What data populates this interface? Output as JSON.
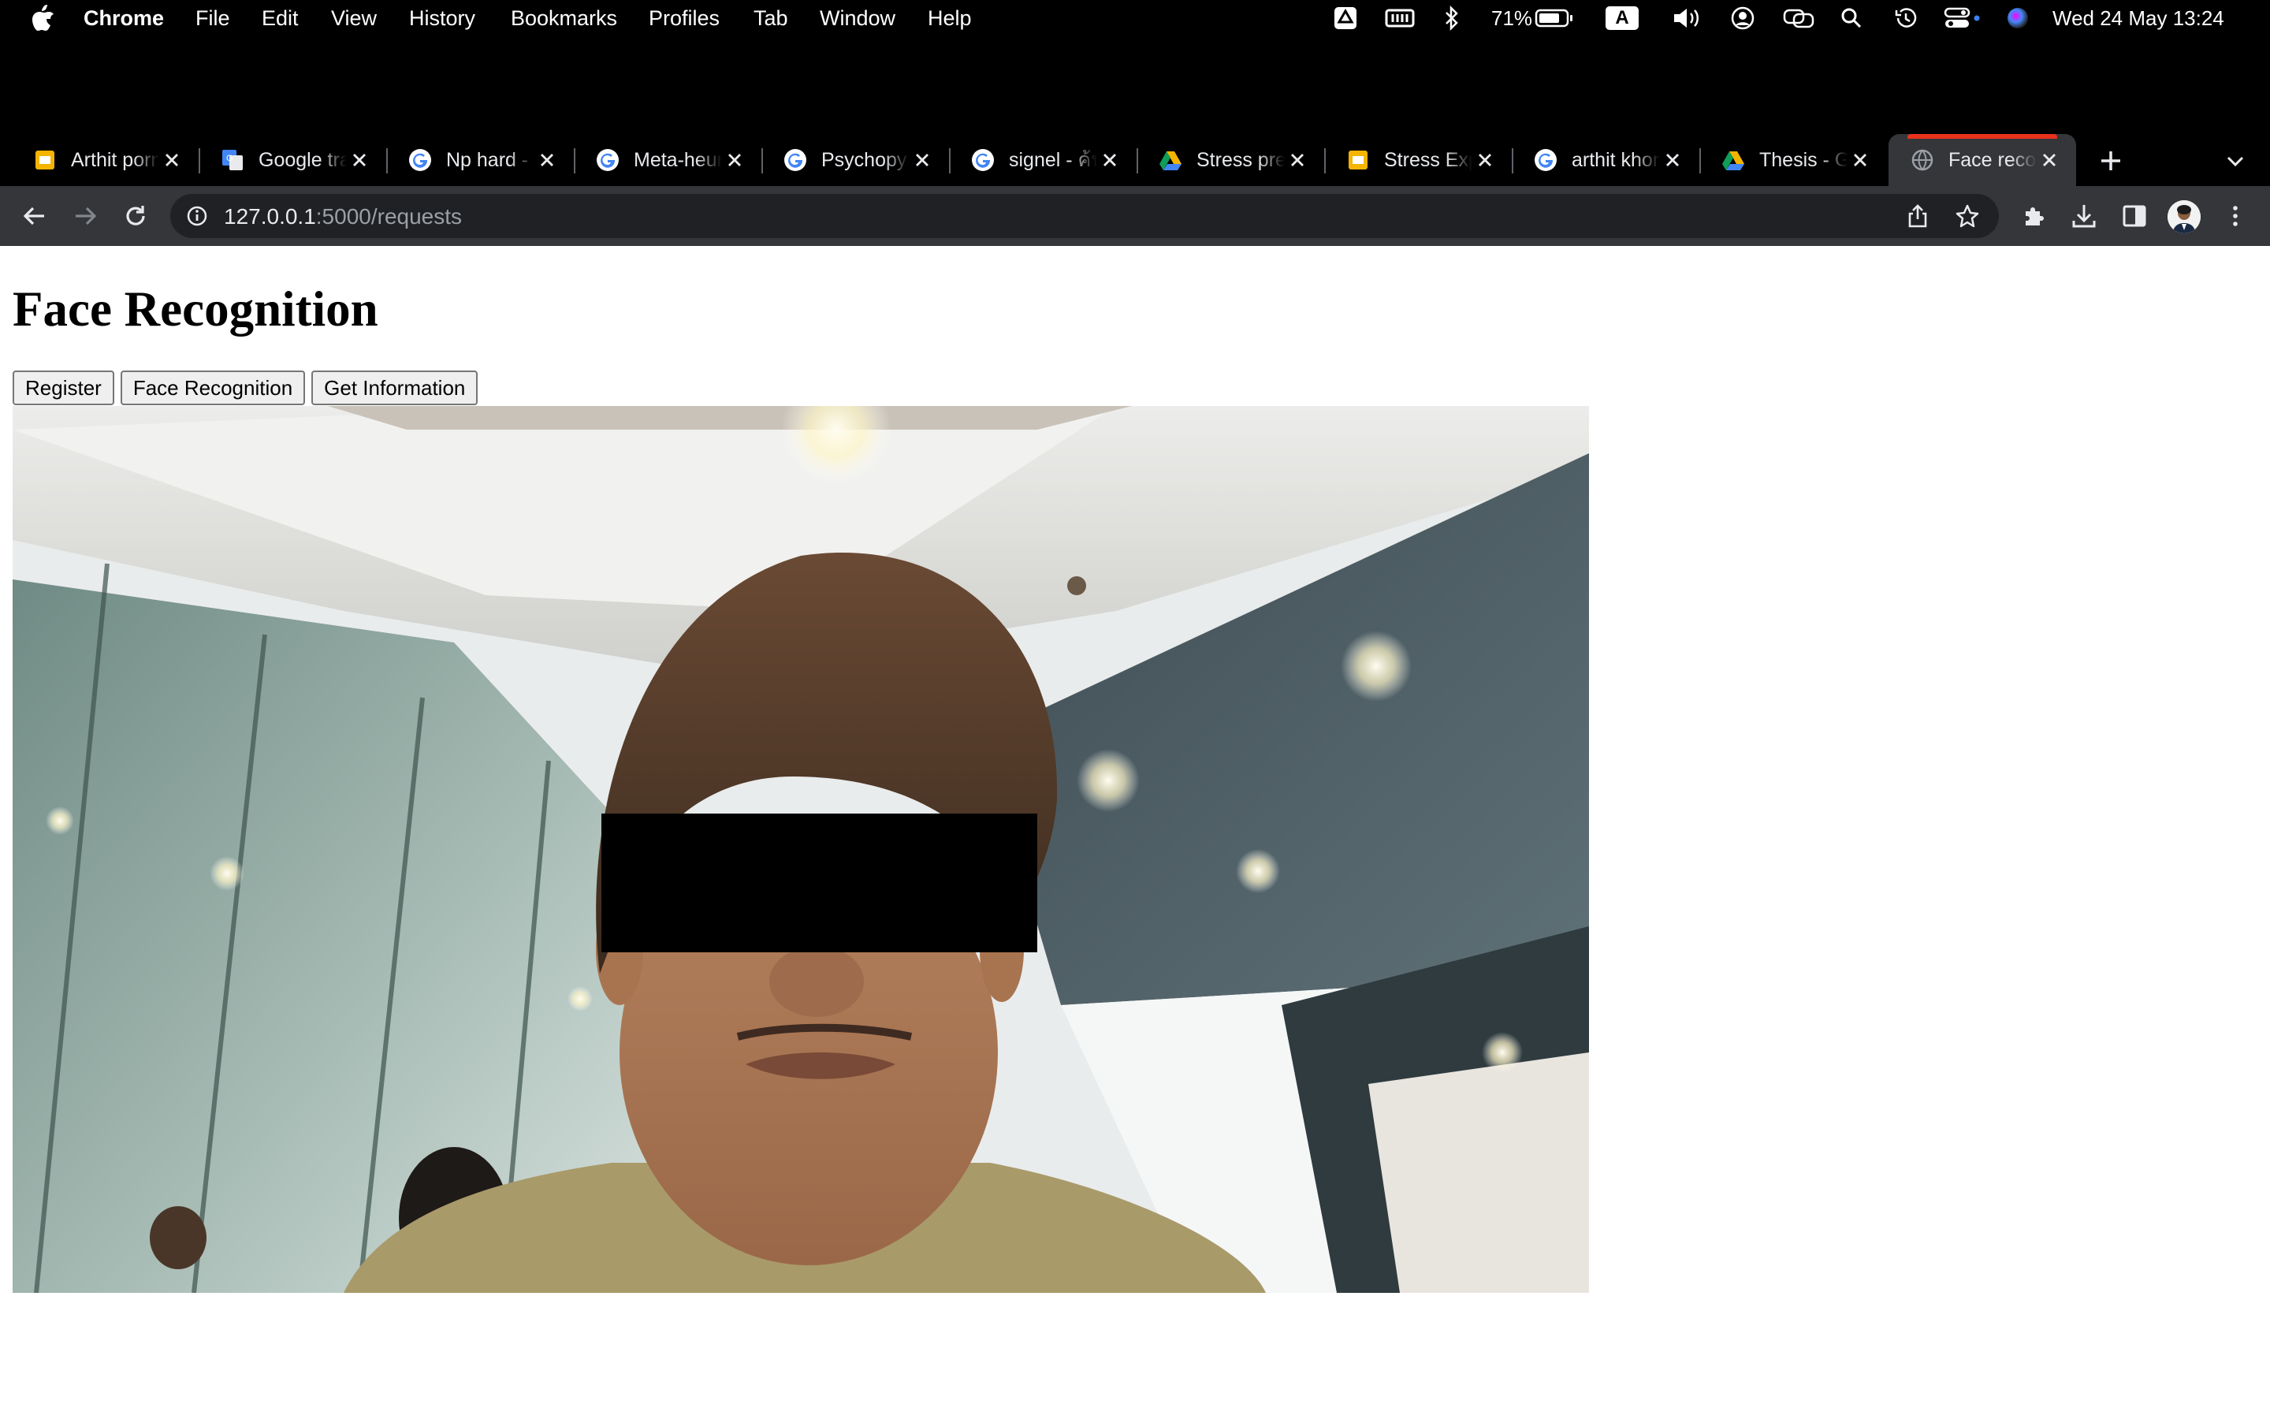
{
  "menubar": {
    "app_name": "Chrome",
    "items": [
      "File",
      "Edit",
      "View",
      "History",
      "Bookmarks",
      "Profiles",
      "Tab",
      "Window",
      "Help"
    ],
    "battery_percent": "71%",
    "input_source": "A",
    "clock": "Wed 24 May  13:24",
    "status_icons": [
      "google-drive-icon",
      "memory-icon",
      "bluetooth-icon",
      "battery-icon",
      "input-source-icon",
      "volume-icon",
      "user-icon",
      "screen-mirroring-icon",
      "spotlight-icon",
      "time-machine-icon",
      "control-center-icon",
      "siri-icon"
    ]
  },
  "tabs": [
    {
      "title": "Arthit porn",
      "favicon": "slides-icon",
      "color": "#f4b400"
    },
    {
      "title": "Google translate",
      "favicon": "translate-icon",
      "color": "#4285f4"
    },
    {
      "title": "Np hard - Google",
      "favicon": "google-icon",
      "color": "#4285f4"
    },
    {
      "title": "Meta-heuristic",
      "favicon": "google-icon",
      "color": "#4285f4"
    },
    {
      "title": "Psychopy",
      "favicon": "google-icon",
      "color": "#4285f4"
    },
    {
      "title": "signel - ค้นหา",
      "favicon": "google-icon",
      "color": "#4285f4"
    },
    {
      "title": "Stress prediction",
      "favicon": "drive-icon",
      "color": "#0f9d58"
    },
    {
      "title": "Stress Experiment",
      "favicon": "slides-icon",
      "color": "#f4b400"
    },
    {
      "title": "arthit khong",
      "favicon": "google-icon",
      "color": "#4285f4"
    },
    {
      "title": "Thesis - Google Drive",
      "favicon": "drive-icon",
      "color": "#0f9d58"
    },
    {
      "title": "Face recognition",
      "favicon": "globe-icon",
      "color": "#9aa0a6",
      "active": true
    }
  ],
  "toolbar": {
    "url_host": "127.0.0.1",
    "url_path": ":5000/requests"
  },
  "page": {
    "title": "Face Recognition",
    "buttons": {
      "register": "Register",
      "face_recognition": "Face Recognition",
      "get_information": "Get Information"
    }
  },
  "colors": {
    "active_tab_accent": "#e8321c",
    "toolbar_bg": "#35363a",
    "omnibox_bg": "#202124"
  }
}
